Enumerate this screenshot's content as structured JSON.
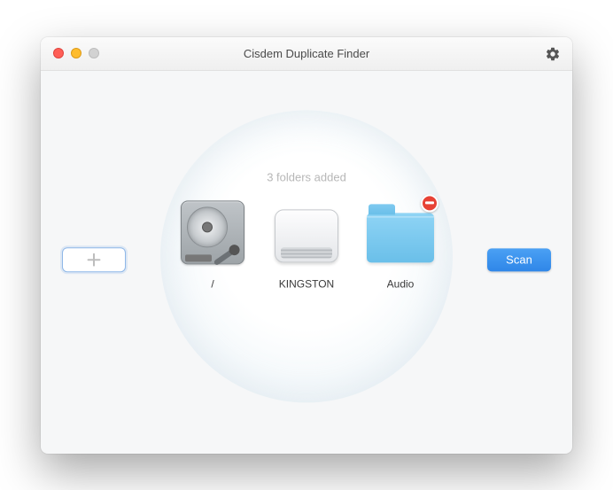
{
  "window": {
    "title": "Cisdem Duplicate Finder"
  },
  "status_text": "3 folders added",
  "scan_label": "Scan",
  "items": [
    {
      "label": "/"
    },
    {
      "label": "KINGSTON"
    },
    {
      "label": "Audio"
    }
  ]
}
